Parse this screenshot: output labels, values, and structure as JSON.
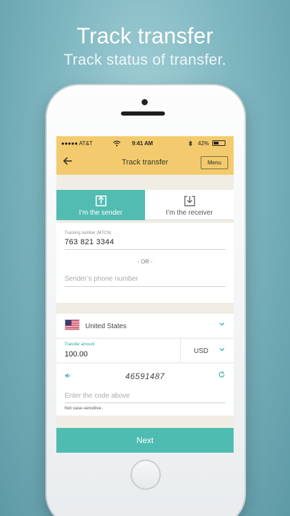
{
  "promo": {
    "headline": "Track transfer",
    "subline": "Track status of transfer."
  },
  "status_bar": {
    "carrier": "●●●●● AT&T",
    "time": "9:41 AM",
    "battery": "42%"
  },
  "nav": {
    "title": "Track transfer",
    "menu_label": "Menu",
    "back_icon": "back-arrow-icon"
  },
  "segment": {
    "sender_label": "I’m the sender",
    "receiver_label": "I’m the receiver",
    "active": "sender"
  },
  "tracking": {
    "label": "Tracking number (MTCN)",
    "value": "763  821  3344",
    "or_text": "- OR -",
    "phone_placeholder": "Sender’s phone number"
  },
  "country": {
    "name": "United States"
  },
  "amount": {
    "label": "Transfer amount",
    "value": "100.00",
    "currency": "USD"
  },
  "captcha": {
    "code": "46591487",
    "placeholder": "Enter the code above",
    "hint": "Not case-sensitive."
  },
  "footer": {
    "next_label": "Next"
  },
  "colors": {
    "accent": "#52bcb3",
    "header": "#f3cb6e",
    "background": "#efede4"
  }
}
